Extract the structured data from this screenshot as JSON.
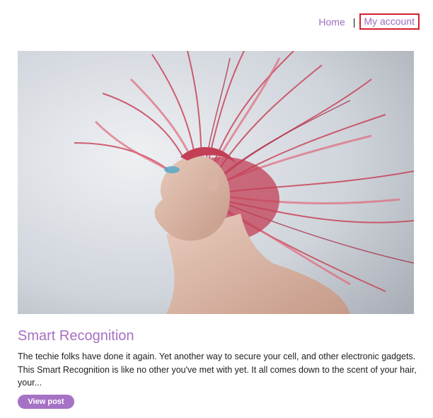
{
  "nav": {
    "home_label": "Home",
    "separator": "|",
    "account_label": "My account"
  },
  "hero": {
    "image_alt": "woman with flying pink hair"
  },
  "post": {
    "title": "Smart Recognition",
    "excerpt": "The techie folks have done it again. Yet another way to secure your cell, and other electronic gadgets. This Smart Recognition is like no other you've met with yet. It all comes down to the scent of your hair, your...",
    "button_label": "View post"
  },
  "colors": {
    "link": "#a06cc0",
    "accent": "#a672c6",
    "highlight_border": "#d41e2c"
  }
}
